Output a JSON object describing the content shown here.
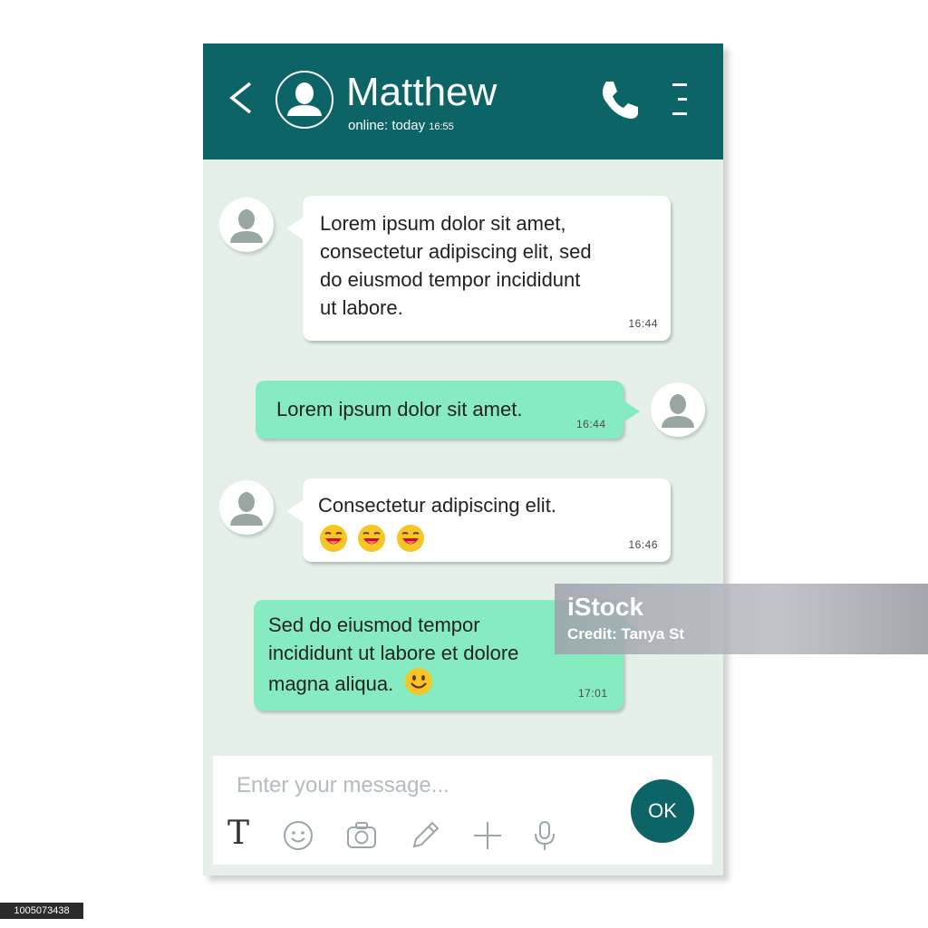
{
  "header": {
    "contact_name": "Matthew",
    "status_label": "online: today",
    "status_time": "16:55",
    "icons": [
      "back-arrow-icon",
      "contact-avatar-icon",
      "phone-icon",
      "menu-icon"
    ]
  },
  "messages": [
    {
      "direction": "incoming",
      "lines": [
        "Lorem ipsum dolor sit amet,",
        "consectetur adipiscing elit, sed",
        "do eiusmod tempor incididunt",
        "ut labore."
      ],
      "time": "16:44"
    },
    {
      "direction": "outgoing",
      "lines": [
        "Lorem ipsum dolor sit amet."
      ],
      "time": "16:44"
    },
    {
      "direction": "incoming",
      "lines": [
        "Consectetur adipiscing elit."
      ],
      "emoji": [
        "grinning-tongue-emoji",
        "grinning-tongue-emoji",
        "grinning-tongue-emoji"
      ],
      "time": "16:46"
    },
    {
      "direction": "outgoing",
      "lines": [
        "Sed do eiusmod tempor",
        "incididunt ut labore et dolore",
        "magna aliqua."
      ],
      "emoji": [
        "smiley-emoji"
      ],
      "time": "17:01"
    }
  ],
  "composer": {
    "placeholder": "Enter your message...",
    "text_tool": "T",
    "tools": [
      "text-format-icon",
      "emoji-icon",
      "camera-icon",
      "pencil-icon",
      "plus-icon",
      "microphone-icon"
    ],
    "send_label": "OK"
  },
  "watermark": {
    "logo": "iStock",
    "credit": "Credit: Tanya St"
  },
  "stock_id": "1005073438",
  "colors": {
    "header": "#0d6467",
    "chat_background": "#e4f0e8",
    "incoming_bubble": "#ffffff",
    "outgoing_bubble": "#87ebc2",
    "send_button": "#0d6467"
  }
}
